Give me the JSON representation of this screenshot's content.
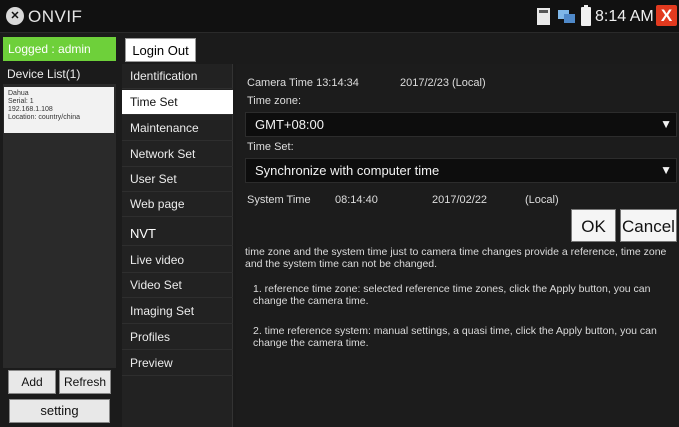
{
  "title_bar": {
    "logo": "ONVIF",
    "app_title": "ONVIF",
    "clock": "8:14 AM",
    "icons": [
      "sd-card-icon",
      "network-icon",
      "battery-icon",
      "close-icon"
    ],
    "close_label": "X"
  },
  "left_panel": {
    "logged_label": "Logged : admin",
    "device_list_header": "Device List(1)",
    "device": {
      "name": "Dahua",
      "serial": "Serial: 1",
      "ip": "192.168.1.108",
      "location": "Location: country/china"
    },
    "add_label": "Add",
    "refresh_label": "Refresh",
    "setting_label": "setting"
  },
  "menu": {
    "login_out_label": "Login Out",
    "items": [
      {
        "label": "Identification",
        "selected": false
      },
      {
        "label": "Time Set",
        "selected": true
      },
      {
        "label": "Maintenance",
        "selected": false
      },
      {
        "label": "Network Set",
        "selected": false
      },
      {
        "label": "User Set",
        "selected": false
      },
      {
        "label": "Web page",
        "selected": false
      },
      {
        "label": "NVT",
        "selected": false
      },
      {
        "label": "Live video",
        "selected": false
      },
      {
        "label": "Video Set",
        "selected": false
      },
      {
        "label": "Imaging Set",
        "selected": false
      },
      {
        "label": "Profiles",
        "selected": false
      },
      {
        "label": "Preview",
        "selected": false
      }
    ]
  },
  "main": {
    "camera_time_label": "Camera Time 13:14:34",
    "camera_date": "2017/2/23 (Local)",
    "time_zone_label": "Time zone:",
    "time_zone_value": "GMT+08:00",
    "time_set_label": "Time Set:",
    "time_set_value": "Synchronize with computer time",
    "system_time_label": "System Time",
    "system_time_value": "08:14:40",
    "system_date_value": "2017/02/22",
    "system_local": "(Local)",
    "ok_label": "OK",
    "cancel_label": "Cancel",
    "dropdown_arrow": "▼",
    "description": [
      "time zone and the system time just to camera time changes provide a reference, time zone and the system time can not be changed.",
      "1. reference time zone: selected reference time zones, click the Apply button, you can change the camera time.",
      "2. time reference system: manual settings, a quasi time, click the Apply button, you can change the camera time."
    ]
  }
}
